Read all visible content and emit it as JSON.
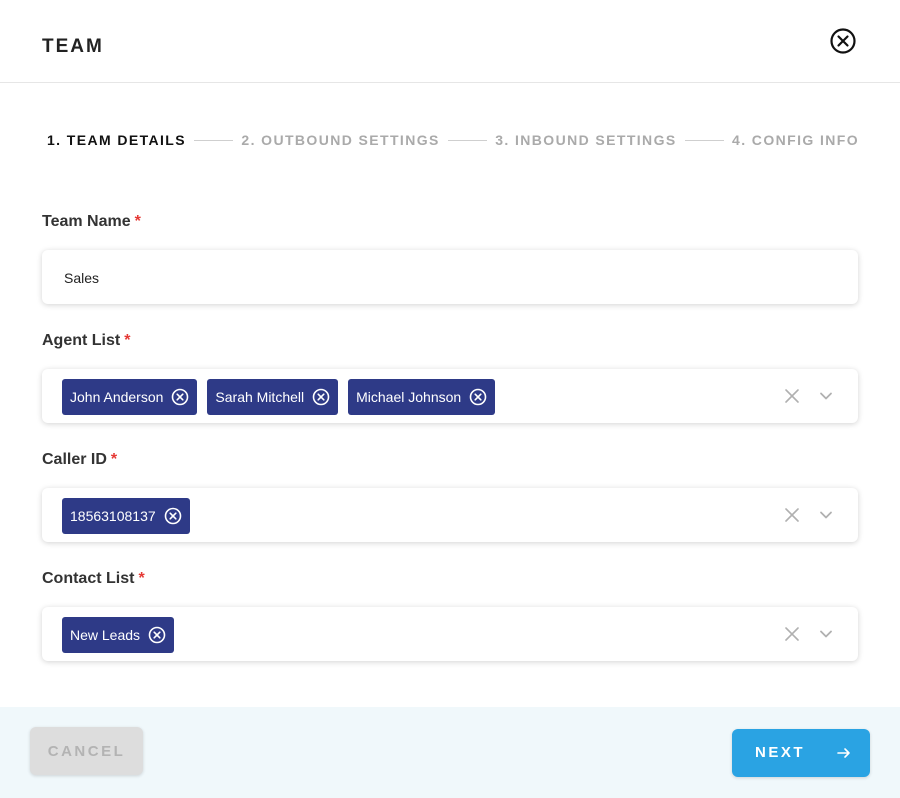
{
  "dialog": {
    "title": "TEAM"
  },
  "steps": [
    {
      "label": "1. TEAM DETAILS",
      "active": true
    },
    {
      "label": "2. OUTBOUND SETTINGS",
      "active": false
    },
    {
      "label": "3. INBOUND SETTINGS",
      "active": false
    },
    {
      "label": "4. CONFIG INFO",
      "active": false
    }
  ],
  "fields": {
    "team_name": {
      "label": "Team Name",
      "required_mark": "*",
      "value": "Sales"
    },
    "agent_list": {
      "label": "Agent List",
      "required_mark": "*",
      "chips": [
        "John Anderson",
        "Sarah Mitchell",
        "Michael Johnson"
      ]
    },
    "caller_id": {
      "label": "Caller ID",
      "required_mark": "*",
      "chips": [
        "18563108137"
      ]
    },
    "contact_list": {
      "label": "Contact List",
      "required_mark": "*",
      "chips": [
        "New Leads"
      ]
    }
  },
  "footer": {
    "cancel_label": "CANCEL",
    "next_label": "NEXT"
  },
  "colors": {
    "chip_bg": "#2e3a87",
    "primary": "#2aa3e3",
    "required": "#e53935",
    "footer_bg": "#f0f8fb"
  },
  "icons": {
    "close": "close-circle-icon",
    "chip_remove": "remove-circle-icon",
    "clear": "clear-x-icon",
    "dropdown": "chevron-down-icon",
    "next": "arrow-right-icon"
  }
}
